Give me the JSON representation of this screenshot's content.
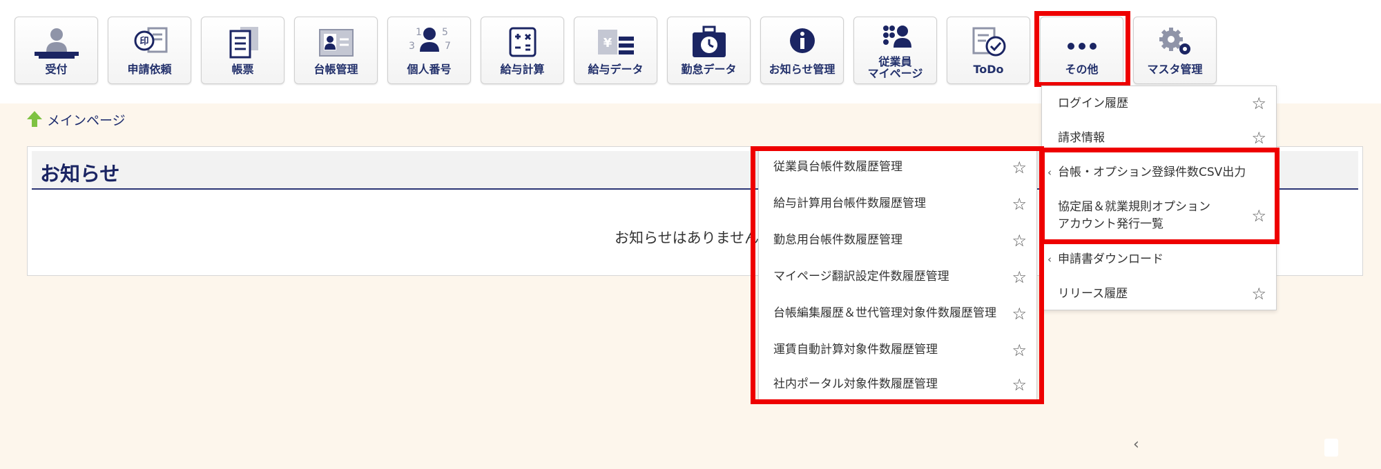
{
  "nav": {
    "items": [
      {
        "label": "受付",
        "icon": "person-desk-icon"
      },
      {
        "label": "申請依頼",
        "icon": "seal-document-icon"
      },
      {
        "label": "帳票",
        "icon": "document-stack-icon"
      },
      {
        "label": "台帳管理",
        "icon": "id-card-icon"
      },
      {
        "label": "個人番号",
        "icon": "person-number-icon"
      },
      {
        "label": "給与計算",
        "icon": "calculator-icon"
      },
      {
        "label": "給与データ",
        "icon": "yen-data-icon"
      },
      {
        "label": "勤怠データ",
        "icon": "clock-bag-icon"
      },
      {
        "label": "お知らせ管理",
        "icon": "info-icon"
      },
      {
        "label_line1": "従業員",
        "label_line2": "マイページ",
        "icon": "employee-mypage-icon"
      },
      {
        "label": "ToDo",
        "icon": "todo-check-icon"
      },
      {
        "label": "その他",
        "icon": "more-dots-icon"
      },
      {
        "label": "マスタ管理",
        "icon": "gears-icon"
      }
    ]
  },
  "breadcrumb": {
    "label": "メインページ",
    "icon": "home-arrow-icon"
  },
  "notice": {
    "title": "お知らせ",
    "empty_message": "お知らせはありません"
  },
  "other_menu": {
    "items": [
      {
        "label": "ログイン履歴",
        "starred": false
      },
      {
        "label": "請求情報",
        "starred": false
      },
      {
        "label": "台帳・オプション登録件数CSV出力",
        "has_submenu": true
      },
      {
        "label_line1": "協定届＆就業規則オプション",
        "label_line2": "アカウント発行一覧",
        "starred": false
      },
      {
        "label": "申請書ダウンロード",
        "has_submenu": true
      },
      {
        "label": "リリース履歴",
        "starred": false
      }
    ]
  },
  "sub_menu": {
    "items": [
      {
        "label": "従業員台帳件数履歴管理"
      },
      {
        "label": "給与計算用台帳件数履歴管理"
      },
      {
        "label": "勤怠用台帳件数履歴管理"
      },
      {
        "label": "マイページ翻訳設定件数履歴管理"
      },
      {
        "label": "台帳編集履歴＆世代管理対象件数履歴管理"
      },
      {
        "label": "運賃自動計算対象件数履歴管理"
      },
      {
        "label": "社内ポータル対象件数履歴管理"
      }
    ]
  },
  "glyphs": {
    "star": "☆",
    "chevron": "‹",
    "prev": "‹"
  },
  "colors": {
    "highlight": "#ee0000",
    "nav_text": "#22306b",
    "page_bg": "#fdf6ec"
  }
}
